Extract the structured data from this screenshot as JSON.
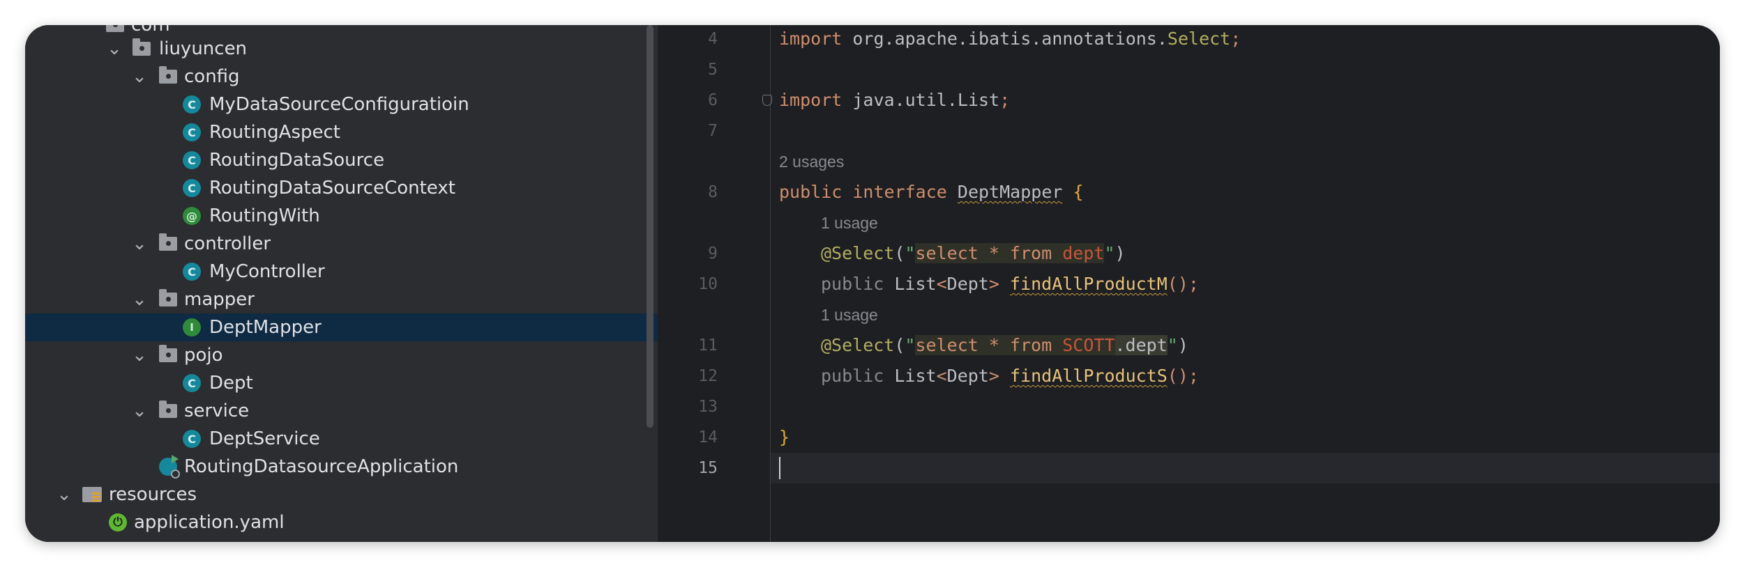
{
  "tree": {
    "items": [
      {
        "label": "com",
        "kind": "folder",
        "expanded": true
      },
      {
        "label": "liuyuncen",
        "kind": "folder",
        "expanded": true
      },
      {
        "label": "config",
        "kind": "folder",
        "expanded": true
      },
      {
        "label": "MyDataSourceConfiguratioin",
        "kind": "class",
        "badge": "C"
      },
      {
        "label": "RoutingAspect",
        "kind": "class",
        "badge": "C"
      },
      {
        "label": "RoutingDataSource",
        "kind": "class",
        "badge": "C"
      },
      {
        "label": "RoutingDataSourceContext",
        "kind": "class",
        "badge": "C"
      },
      {
        "label": "RoutingWith",
        "kind": "annotation",
        "badge": "@"
      },
      {
        "label": "controller",
        "kind": "folder",
        "expanded": true
      },
      {
        "label": "MyController",
        "kind": "class",
        "badge": "C"
      },
      {
        "label": "mapper",
        "kind": "folder",
        "expanded": true
      },
      {
        "label": "DeptMapper",
        "kind": "interface",
        "badge": "I",
        "selected": true
      },
      {
        "label": "pojo",
        "kind": "folder",
        "expanded": true
      },
      {
        "label": "Dept",
        "kind": "class",
        "badge": "C"
      },
      {
        "label": "service",
        "kind": "folder",
        "expanded": true
      },
      {
        "label": "DeptService",
        "kind": "class",
        "badge": "C"
      },
      {
        "label": "RoutingDatasourceApplication",
        "kind": "app-class"
      },
      {
        "label": "resources",
        "kind": "resources-folder",
        "expanded": true
      },
      {
        "label": "application.yaml",
        "kind": "yaml"
      }
    ]
  },
  "editor": {
    "line_numbers": [
      "4",
      "5",
      "6",
      "7",
      "8",
      "9",
      "10",
      "11",
      "12",
      "13",
      "14",
      "15"
    ],
    "current_line": "15",
    "hints": {
      "usages_2": "2 usages",
      "usage_1a": "1 usage",
      "usage_1b": "1 usage"
    },
    "tokens": {
      "import": "import",
      "pkg_ibatis": "org.apache.ibatis.annotations.",
      "select_cls": "Select",
      "semi": ";",
      "pkg_list": "java.util.List",
      "public": "public",
      "interface": "interface",
      "iface_name": "DeptMapper",
      "lbrace": "{",
      "at_select": "@Select",
      "lparen": "(",
      "rparen": ")",
      "quote": "\"",
      "sql_select": "select",
      "sql_star": " * ",
      "sql_from": "from",
      "sql_dept": "dept",
      "sql_scott": "SCOTT",
      "sql_dot_dept": ".dept",
      "list_type": "List",
      "lt": "<",
      "gt": ">",
      "dept_type": "Dept",
      "fn_m": "findAllProductM",
      "fn_s": "findAllProductS",
      "parens_semi": "();",
      "rbrace": "}"
    }
  },
  "colors": {
    "keyword": "#cf8e6d",
    "annotation": "#b3ae60",
    "method": "#e8c27a",
    "selection": "#0f2a43",
    "class_badge": "#15899b",
    "interface_badge": "#2f8a3c"
  }
}
